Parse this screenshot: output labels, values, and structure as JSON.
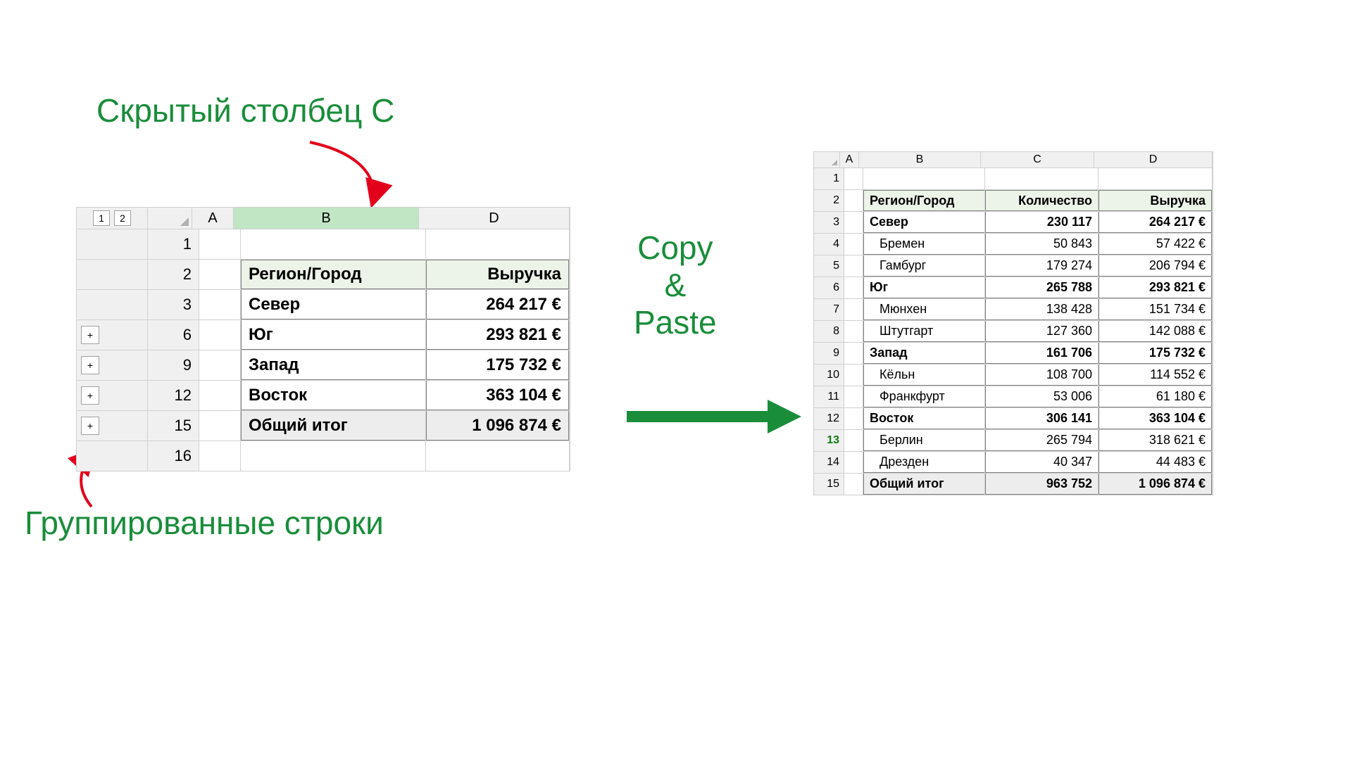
{
  "annotations": {
    "hidden_col": "Скрытый столбец С",
    "grouped_rows": "Группированные строки",
    "copy_paste": "Copy\n&\nPaste"
  },
  "left": {
    "outline_levels": [
      "1",
      "2"
    ],
    "columns": [
      "A",
      "B",
      "D"
    ],
    "selected_column": "B",
    "row_numbers": [
      "1",
      "2",
      "3",
      "6",
      "9",
      "12",
      "15",
      "16"
    ],
    "outline_buttons": [
      null,
      null,
      null,
      "+",
      "+",
      "+",
      "+",
      null
    ],
    "headers": {
      "b": "Регион/Город",
      "d": "Выручка"
    },
    "rows": [
      {
        "b": "Север",
        "d": "264 217 €"
      },
      {
        "b": "Юг",
        "d": "293 821 €"
      },
      {
        "b": "Запад",
        "d": "175 732 €"
      },
      {
        "b": "Восток",
        "d": "363 104 €"
      }
    ],
    "total": {
      "b": "Общий итог",
      "d": "1 096 874 €"
    }
  },
  "right": {
    "columns": [
      "A",
      "B",
      "C",
      "D"
    ],
    "row_numbers": [
      "1",
      "2",
      "3",
      "4",
      "5",
      "6",
      "7",
      "8",
      "9",
      "10",
      "11",
      "12",
      "13",
      "14",
      "15"
    ],
    "active_row": "13",
    "headers": {
      "b": "Регион/Город",
      "c": "Количество",
      "d": "Выручка"
    },
    "rows": [
      {
        "b": "Север",
        "c": "230 117",
        "d": "264 217 €",
        "bold": true
      },
      {
        "b": "Бремен",
        "c": "50 843",
        "d": "57 422 €",
        "bold": false
      },
      {
        "b": "Гамбург",
        "c": "179 274",
        "d": "206 794 €",
        "bold": false
      },
      {
        "b": "Юг",
        "c": "265 788",
        "d": "293 821 €",
        "bold": true
      },
      {
        "b": "Мюнхен",
        "c": "138 428",
        "d": "151 734 €",
        "bold": false
      },
      {
        "b": "Штутгарт",
        "c": "127 360",
        "d": "142 088 €",
        "bold": false
      },
      {
        "b": "Запад",
        "c": "161 706",
        "d": "175 732 €",
        "bold": true
      },
      {
        "b": "Кёльн",
        "c": "108 700",
        "d": "114 552 €",
        "bold": false
      },
      {
        "b": "Франкфурт",
        "c": "53 006",
        "d": "61 180 €",
        "bold": false
      },
      {
        "b": "Восток",
        "c": "306 141",
        "d": "363 104 €",
        "bold": true
      },
      {
        "b": "Берлин",
        "c": "265 794",
        "d": "318 621 €",
        "bold": false
      },
      {
        "b": "Дрезден",
        "c": "40 347",
        "d": "44 483 €",
        "bold": false
      }
    ],
    "total": {
      "b": "Общий итог",
      "c": "963 752",
      "d": "1 096 874 €"
    }
  },
  "chart_data": [
    {
      "type": "table",
      "title": "Source (hidden col C, grouped rows)",
      "columns": [
        "Регион/Город",
        "Выручка"
      ],
      "rows": [
        [
          "Север",
          "264 217 €"
        ],
        [
          "Юг",
          "293 821 €"
        ],
        [
          "Запад",
          "175 732 €"
        ],
        [
          "Восток",
          "363 104 €"
        ],
        [
          "Общий итог",
          "1 096 874 €"
        ]
      ]
    },
    {
      "type": "table",
      "title": "Pasted result (all rows & hidden column revealed)",
      "columns": [
        "Регион/Город",
        "Количество",
        "Выручка"
      ],
      "rows": [
        [
          "Север",
          "230 117",
          "264 217 €"
        ],
        [
          "Бремен",
          "50 843",
          "57 422 €"
        ],
        [
          "Гамбург",
          "179 274",
          "206 794 €"
        ],
        [
          "Юг",
          "265 788",
          "293 821 €"
        ],
        [
          "Мюнхен",
          "138 428",
          "151 734 €"
        ],
        [
          "Штутгарт",
          "127 360",
          "142 088 €"
        ],
        [
          "Запад",
          "161 706",
          "175 732 €"
        ],
        [
          "Кёльн",
          "108 700",
          "114 552 €"
        ],
        [
          "Франкфурт",
          "53 006",
          "61 180 €"
        ],
        [
          "Восток",
          "306 141",
          "363 104 €"
        ],
        [
          "Берлин",
          "265 794",
          "318 621 €"
        ],
        [
          "Дрезден",
          "40 347",
          "44 483 €"
        ],
        [
          "Общий итог",
          "963 752",
          "1 096 874 €"
        ]
      ]
    }
  ]
}
